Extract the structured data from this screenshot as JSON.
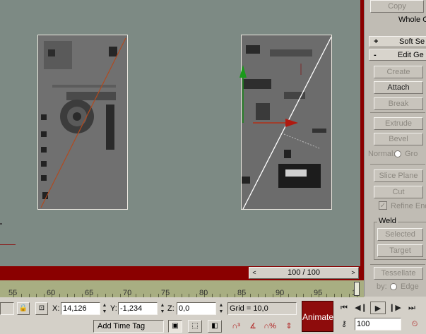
{
  "command_panel": {
    "copy_label": "Copy",
    "whole_label": "Whole O",
    "soft_selection": {
      "sign": "+",
      "label": "Soft Se"
    },
    "edit_geometry": {
      "sign": "-",
      "label": "Edit Ge"
    },
    "buttons": {
      "create": "Create",
      "attach": "Attach",
      "break": "Break",
      "extrude": "Extrude",
      "bevel": "Bevel",
      "normal": "Normal:",
      "normal_opt": "Gro",
      "slice_plane": "Slice Plane",
      "cut": "Cut",
      "refine_ends": "Refine End",
      "weld_group": "Weld",
      "selected": "Selected",
      "target": "Target",
      "tessellate": "Tessellate",
      "by": "by:",
      "edge": "Edge"
    }
  },
  "time_slider": {
    "value": "100 / 100",
    "prev_arrow": "<",
    "next_arrow": ">"
  },
  "trackbar": {
    "labels": [
      "55",
      "60",
      "65",
      "70",
      "75",
      "80",
      "85",
      "90",
      "95",
      "1"
    ]
  },
  "status": {
    "x_label": "X:",
    "x_value": "14,126",
    "y_label": "Y:",
    "y_value": "-1,234",
    "z_label": "Z:",
    "z_value": "0,0",
    "grid": "Grid = 10,0",
    "add_time_tag": "Add Time Tag",
    "animate": "Animate",
    "frame_value": "100"
  },
  "colors": {
    "viewport_bg": "#7d8a84",
    "active_border": "#8a0000",
    "trackbar": "#a8ae82",
    "animate_button": "#8e0c0c"
  }
}
